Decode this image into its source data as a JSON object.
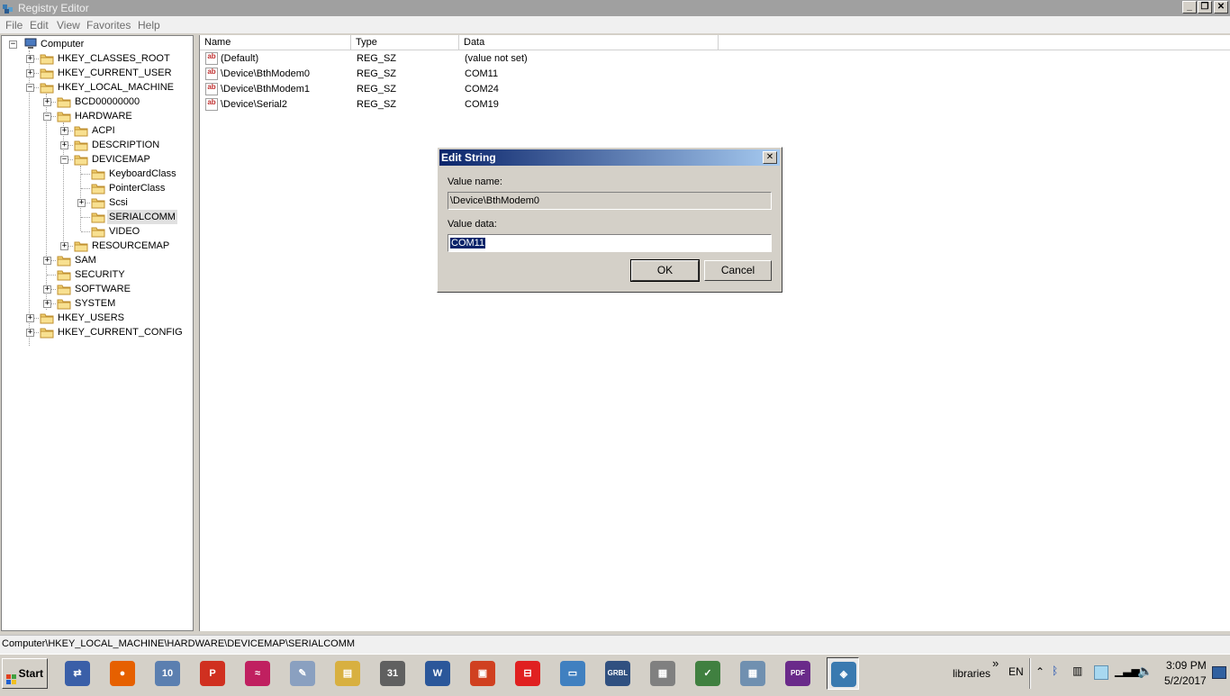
{
  "window": {
    "title": "Registry Editor",
    "buttons": {
      "minimize": "_",
      "restore": "❐",
      "close": "✕"
    }
  },
  "menu": [
    "File",
    "Edit",
    "View",
    "Favorites",
    "Help"
  ],
  "tree": {
    "root": "Computer",
    "items": [
      {
        "label": "HKEY_CLASSES_ROOT",
        "expander": "+"
      },
      {
        "label": "HKEY_CURRENT_USER",
        "expander": "+"
      },
      {
        "label": "HKEY_LOCAL_MACHINE",
        "expander": "−"
      },
      {
        "label": "BCD00000000",
        "expander": "+"
      },
      {
        "label": "HARDWARE",
        "expander": "−"
      },
      {
        "label": "ACPI",
        "expander": "+"
      },
      {
        "label": "DESCRIPTION",
        "expander": "+"
      },
      {
        "label": "DEVICEMAP",
        "expander": "−"
      },
      {
        "label": "KeyboardClass",
        "expander": ""
      },
      {
        "label": "PointerClass",
        "expander": ""
      },
      {
        "label": "Scsi",
        "expander": "+"
      },
      {
        "label": "SERIALCOMM",
        "expander": "",
        "selected": true
      },
      {
        "label": "VIDEO",
        "expander": ""
      },
      {
        "label": "RESOURCEMAP",
        "expander": "+"
      },
      {
        "label": "SAM",
        "expander": "+"
      },
      {
        "label": "SECURITY",
        "expander": ""
      },
      {
        "label": "SOFTWARE",
        "expander": "+"
      },
      {
        "label": "SYSTEM",
        "expander": "+"
      },
      {
        "label": "HKEY_USERS",
        "expander": "+"
      },
      {
        "label": "HKEY_CURRENT_CONFIG",
        "expander": "+"
      }
    ]
  },
  "list": {
    "columns": [
      "Name",
      "Type",
      "Data"
    ],
    "rows": [
      {
        "name": "(Default)",
        "type": "REG_SZ",
        "data": "(value not set)"
      },
      {
        "name": "\\Device\\BthModem0",
        "type": "REG_SZ",
        "data": "COM11"
      },
      {
        "name": "\\Device\\BthModem1",
        "type": "REG_SZ",
        "data": "COM24"
      },
      {
        "name": "\\Device\\Serial2",
        "type": "REG_SZ",
        "data": "COM19"
      }
    ],
    "value_icon": "ab"
  },
  "status": {
    "path": "Computer\\HKEY_LOCAL_MACHINE\\HARDWARE\\DEVICEMAP\\SERIALCOMM"
  },
  "dialog": {
    "title": "Edit String",
    "value_name_label": "Value name:",
    "value_name": "\\Device\\BthModem0",
    "value_data_label": "Value data:",
    "value_data": "COM11",
    "ok": "OK",
    "cancel": "Cancel",
    "close": "✕"
  },
  "taskbar": {
    "start": "Start",
    "apps": [
      {
        "icon": "network-icon",
        "glyph": "⇄",
        "color": "#3a5fa8"
      },
      {
        "icon": "firefox-icon",
        "glyph": "●",
        "color": "#e66000"
      },
      {
        "icon": "win10-icon",
        "glyph": "10",
        "color": "#5b7fb0"
      },
      {
        "icon": "p-app-icon",
        "glyph": "P",
        "color": "#d03020"
      },
      {
        "icon": "wifi-app-icon",
        "glyph": "≈",
        "color": "#c02060"
      },
      {
        "icon": "paint-icon",
        "glyph": "✎",
        "color": "#8aa0c0"
      },
      {
        "icon": "explorer-icon",
        "glyph": "▤",
        "color": "#d8b040"
      },
      {
        "icon": "calendar-icon",
        "glyph": "31",
        "color": "#606060"
      },
      {
        "icon": "word-icon",
        "glyph": "W",
        "color": "#2b579a"
      },
      {
        "icon": "app-red-icon",
        "glyph": "▣",
        "color": "#d04020"
      },
      {
        "icon": "app-red2-icon",
        "glyph": "⊟",
        "color": "#e02020"
      },
      {
        "icon": "monitor-icon",
        "glyph": "▭",
        "color": "#4080c0"
      },
      {
        "icon": "grbl-icon",
        "glyph": "GRBL",
        "color": "#305080"
      },
      {
        "icon": "doc-icon",
        "glyph": "▦",
        "color": "#808080"
      },
      {
        "icon": "chart-app-icon",
        "glyph": "✓",
        "color": "#408040"
      },
      {
        "icon": "calculator-icon",
        "glyph": "▦",
        "color": "#7090b0"
      },
      {
        "icon": "pdf-icon",
        "glyph": "PDF",
        "color": "#6a2a8a"
      },
      {
        "icon": "regedit-icon",
        "glyph": "◈",
        "color": "#3a7ab0"
      }
    ],
    "libraries": "libraries",
    "chevron": "»",
    "lang": "EN",
    "time": "3:09 PM",
    "date": "5/2/2017"
  }
}
